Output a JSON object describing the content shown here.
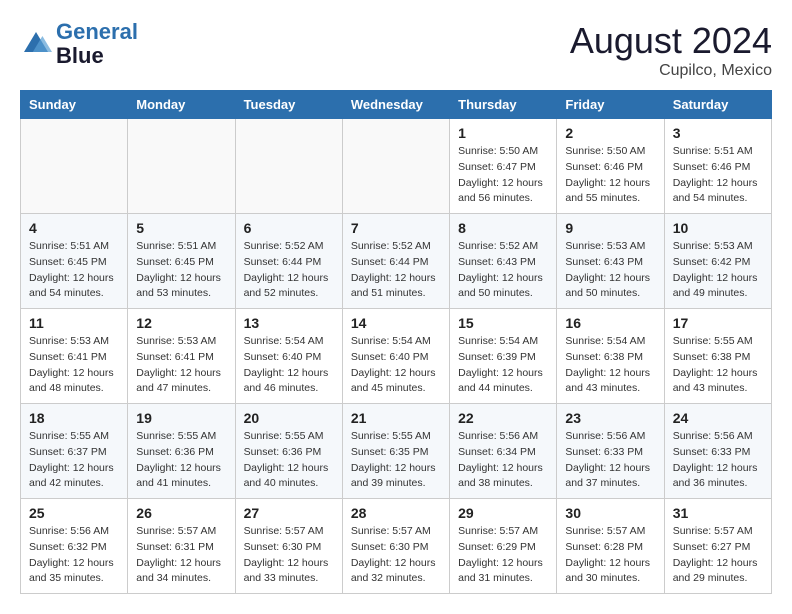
{
  "header": {
    "logo_line1": "General",
    "logo_line2": "Blue",
    "month": "August 2024",
    "location": "Cupilco, Mexico"
  },
  "days_of_week": [
    "Sunday",
    "Monday",
    "Tuesday",
    "Wednesday",
    "Thursday",
    "Friday",
    "Saturday"
  ],
  "weeks": [
    [
      {
        "day": "",
        "sunrise": "",
        "sunset": "",
        "daylight": ""
      },
      {
        "day": "",
        "sunrise": "",
        "sunset": "",
        "daylight": ""
      },
      {
        "day": "",
        "sunrise": "",
        "sunset": "",
        "daylight": ""
      },
      {
        "day": "",
        "sunrise": "",
        "sunset": "",
        "daylight": ""
      },
      {
        "day": "1",
        "sunrise": "5:50 AM",
        "sunset": "6:47 PM",
        "daylight": "12 hours and 56 minutes."
      },
      {
        "day": "2",
        "sunrise": "5:50 AM",
        "sunset": "6:46 PM",
        "daylight": "12 hours and 55 minutes."
      },
      {
        "day": "3",
        "sunrise": "5:51 AM",
        "sunset": "6:46 PM",
        "daylight": "12 hours and 54 minutes."
      }
    ],
    [
      {
        "day": "4",
        "sunrise": "5:51 AM",
        "sunset": "6:45 PM",
        "daylight": "12 hours and 54 minutes."
      },
      {
        "day": "5",
        "sunrise": "5:51 AM",
        "sunset": "6:45 PM",
        "daylight": "12 hours and 53 minutes."
      },
      {
        "day": "6",
        "sunrise": "5:52 AM",
        "sunset": "6:44 PM",
        "daylight": "12 hours and 52 minutes."
      },
      {
        "day": "7",
        "sunrise": "5:52 AM",
        "sunset": "6:44 PM",
        "daylight": "12 hours and 51 minutes."
      },
      {
        "day": "8",
        "sunrise": "5:52 AM",
        "sunset": "6:43 PM",
        "daylight": "12 hours and 50 minutes."
      },
      {
        "day": "9",
        "sunrise": "5:53 AM",
        "sunset": "6:43 PM",
        "daylight": "12 hours and 50 minutes."
      },
      {
        "day": "10",
        "sunrise": "5:53 AM",
        "sunset": "6:42 PM",
        "daylight": "12 hours and 49 minutes."
      }
    ],
    [
      {
        "day": "11",
        "sunrise": "5:53 AM",
        "sunset": "6:41 PM",
        "daylight": "12 hours and 48 minutes."
      },
      {
        "day": "12",
        "sunrise": "5:53 AM",
        "sunset": "6:41 PM",
        "daylight": "12 hours and 47 minutes."
      },
      {
        "day": "13",
        "sunrise": "5:54 AM",
        "sunset": "6:40 PM",
        "daylight": "12 hours and 46 minutes."
      },
      {
        "day": "14",
        "sunrise": "5:54 AM",
        "sunset": "6:40 PM",
        "daylight": "12 hours and 45 minutes."
      },
      {
        "day": "15",
        "sunrise": "5:54 AM",
        "sunset": "6:39 PM",
        "daylight": "12 hours and 44 minutes."
      },
      {
        "day": "16",
        "sunrise": "5:54 AM",
        "sunset": "6:38 PM",
        "daylight": "12 hours and 43 minutes."
      },
      {
        "day": "17",
        "sunrise": "5:55 AM",
        "sunset": "6:38 PM",
        "daylight": "12 hours and 43 minutes."
      }
    ],
    [
      {
        "day": "18",
        "sunrise": "5:55 AM",
        "sunset": "6:37 PM",
        "daylight": "12 hours and 42 minutes."
      },
      {
        "day": "19",
        "sunrise": "5:55 AM",
        "sunset": "6:36 PM",
        "daylight": "12 hours and 41 minutes."
      },
      {
        "day": "20",
        "sunrise": "5:55 AM",
        "sunset": "6:36 PM",
        "daylight": "12 hours and 40 minutes."
      },
      {
        "day": "21",
        "sunrise": "5:55 AM",
        "sunset": "6:35 PM",
        "daylight": "12 hours and 39 minutes."
      },
      {
        "day": "22",
        "sunrise": "5:56 AM",
        "sunset": "6:34 PM",
        "daylight": "12 hours and 38 minutes."
      },
      {
        "day": "23",
        "sunrise": "5:56 AM",
        "sunset": "6:33 PM",
        "daylight": "12 hours and 37 minutes."
      },
      {
        "day": "24",
        "sunrise": "5:56 AM",
        "sunset": "6:33 PM",
        "daylight": "12 hours and 36 minutes."
      }
    ],
    [
      {
        "day": "25",
        "sunrise": "5:56 AM",
        "sunset": "6:32 PM",
        "daylight": "12 hours and 35 minutes."
      },
      {
        "day": "26",
        "sunrise": "5:57 AM",
        "sunset": "6:31 PM",
        "daylight": "12 hours and 34 minutes."
      },
      {
        "day": "27",
        "sunrise": "5:57 AM",
        "sunset": "6:30 PM",
        "daylight": "12 hours and 33 minutes."
      },
      {
        "day": "28",
        "sunrise": "5:57 AM",
        "sunset": "6:30 PM",
        "daylight": "12 hours and 32 minutes."
      },
      {
        "day": "29",
        "sunrise": "5:57 AM",
        "sunset": "6:29 PM",
        "daylight": "12 hours and 31 minutes."
      },
      {
        "day": "30",
        "sunrise": "5:57 AM",
        "sunset": "6:28 PM",
        "daylight": "12 hours and 30 minutes."
      },
      {
        "day": "31",
        "sunrise": "5:57 AM",
        "sunset": "6:27 PM",
        "daylight": "12 hours and 29 minutes."
      }
    ]
  ]
}
